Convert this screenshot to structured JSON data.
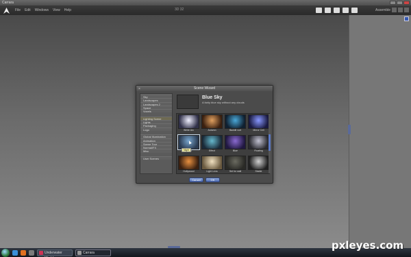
{
  "window": {
    "title": "Carrara"
  },
  "menu": {
    "items": [
      "File",
      "Edit",
      "Windows",
      "View",
      "Help"
    ],
    "center_label": "3D 32",
    "workspace_label": "Assemble"
  },
  "dialog": {
    "title": "Scene Wizard",
    "categories": [
      "Sky",
      "Landscapes",
      "Landscapes 2",
      "Space",
      "Voxels",
      "",
      "Lighting Scene",
      "Lights",
      "Packaging",
      "Logo",
      "",
      "Global Illumination",
      "Animation",
      "Scene Tour",
      "Normal/FX",
      "Misc",
      "",
      "User Scenes"
    ],
    "selected_category_index": 6,
    "selected_title": "Blue Sky",
    "selected_desc": "A fairly blue sky without any clouds",
    "thumbnails": [
      {
        "label": "White Arc",
        "color_a": "#f0f0ff",
        "color_b": "#303048"
      },
      {
        "label": "Autumn",
        "color_a": "#e0a060",
        "color_b": "#3a2010"
      },
      {
        "label": "Backlit vort",
        "color_a": "#4aa8d8",
        "color_b": "#102030"
      },
      {
        "label": "Mirror Cell",
        "color_a": "#8898ff",
        "color_b": "#1a1a40"
      },
      {
        "label": "Night",
        "color_a": "#7aa8d0",
        "color_b": "#2a3a50"
      },
      {
        "label": "Effect",
        "color_a": "#66b8cc",
        "color_b": "#1a2a38"
      },
      {
        "label": "Blue",
        "color_a": "#8a6ad0",
        "color_b": "#201840"
      },
      {
        "label": "Floating",
        "color_a": "#c0c0d0",
        "color_b": "#2a2a30"
      },
      {
        "label": "Hollywood",
        "color_a": "#e89040",
        "color_b": "#3a2010"
      },
      {
        "label": "Light Lens",
        "color_a": "#f0e0c0",
        "color_b": "#6a5a40"
      },
      {
        "label": "Set for wall",
        "color_a": "#6a6a60",
        "color_b": "#2a2a26"
      },
      {
        "label": "Stable",
        "color_a": "#d0d0d0",
        "color_b": "#202020"
      }
    ],
    "hover_tooltip": "Night",
    "cancel_label": "Cancel",
    "ok_label": "OK"
  },
  "taskbar": {
    "tasks": [
      "Underwater World - ...",
      "Carrara"
    ]
  },
  "watermark": "pxleyes.com"
}
